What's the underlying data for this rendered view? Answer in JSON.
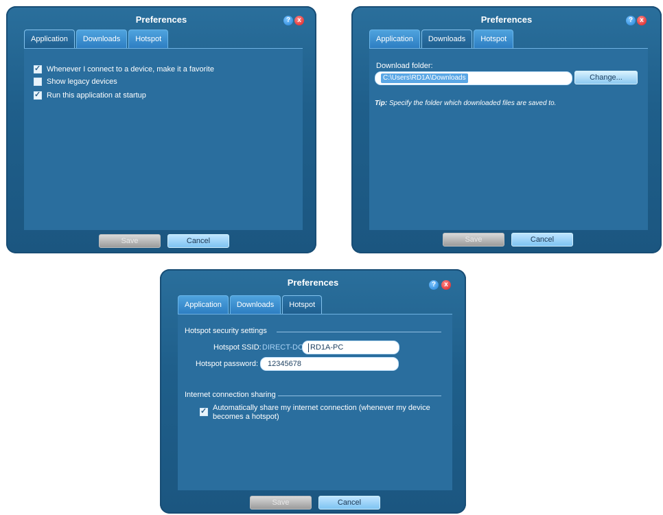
{
  "dialogs": {
    "application": {
      "title": "Preferences",
      "tabs": [
        "Application",
        "Downloads",
        "Hotspot"
      ],
      "active_tab": "Application",
      "checkboxes": [
        {
          "label": "Whenever I connect to a device, make it a favorite",
          "checked": true
        },
        {
          "label": "Show legacy devices",
          "checked": false
        },
        {
          "label": "Run this application at startup",
          "checked": true
        }
      ],
      "buttons": {
        "save": "Save",
        "cancel": "Cancel"
      },
      "icons": {
        "help": "?",
        "close": "x"
      }
    },
    "downloads": {
      "title": "Preferences",
      "tabs": [
        "Application",
        "Downloads",
        "Hotspot"
      ],
      "active_tab": "Downloads",
      "download_folder_label": "Download folder:",
      "download_folder_value": "C:\\Users\\RD1A\\Downloads",
      "change_button": "Change...",
      "tip_prefix": "Tip:",
      "tip_text": "Specify the folder which downloaded files are saved to.",
      "buttons": {
        "save": "Save",
        "cancel": "Cancel"
      },
      "icons": {
        "help": "?",
        "close": "x"
      }
    },
    "hotspot": {
      "title": "Preferences",
      "tabs": [
        "Application",
        "Downloads",
        "Hotspot"
      ],
      "active_tab": "Hotspot",
      "security_heading": "Hotspot security settings",
      "ssid_label": "Hotspot SSID:",
      "ssid_prefix": "DIRECT-DC-",
      "ssid_value": "RD1A-PC",
      "password_label": "Hotspot password:",
      "password_value": "12345678",
      "sharing_heading": "Internet connection sharing",
      "share_checkbox": {
        "label_line1": "Automatically share my internet connection (whenever my device",
        "label_line2": "becomes a hotspot)",
        "checked": true
      },
      "buttons": {
        "save": "Save",
        "cancel": "Cancel"
      },
      "icons": {
        "help": "?",
        "close": "x"
      }
    }
  }
}
